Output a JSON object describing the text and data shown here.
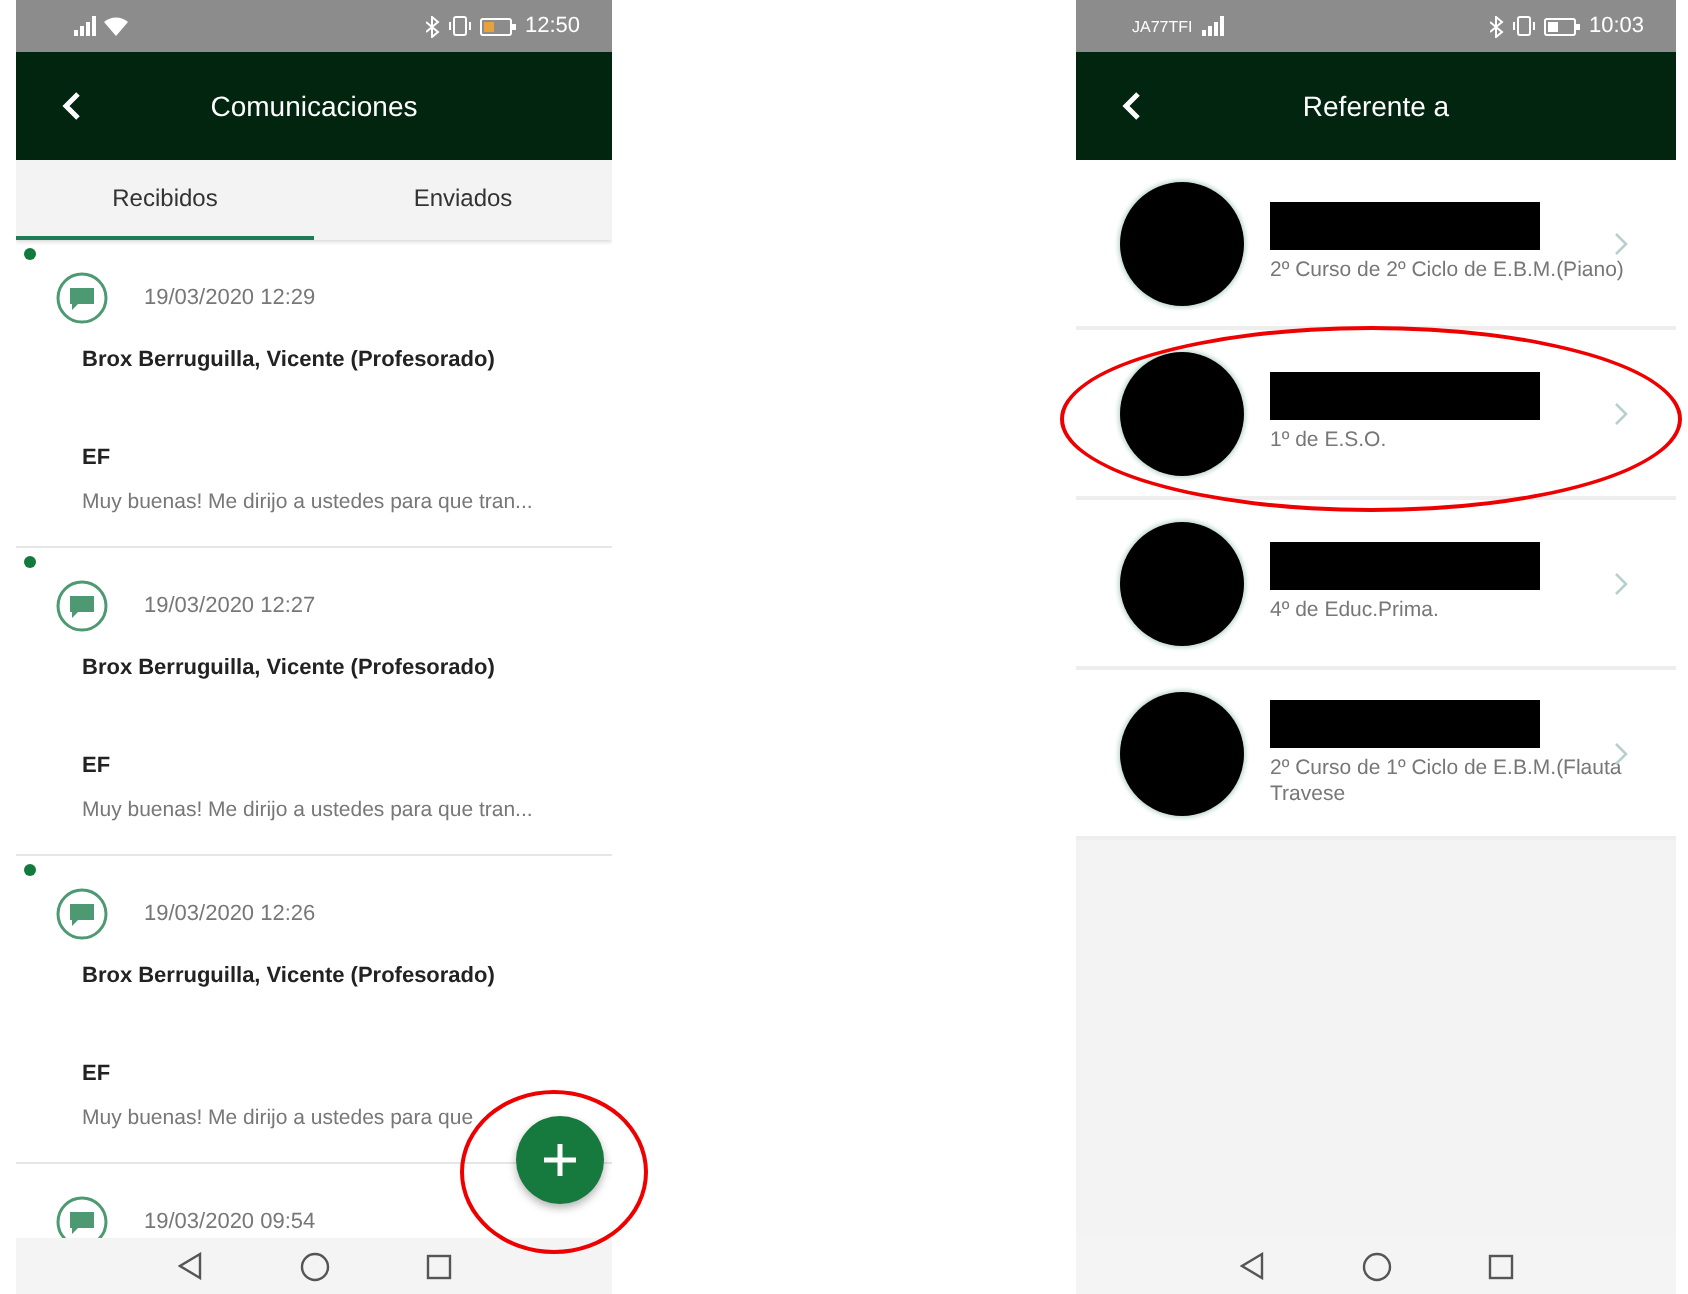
{
  "left_screen": {
    "status_bar": {
      "time": "12:50"
    },
    "header": {
      "title": "Comunicaciones"
    },
    "tabs": [
      {
        "label": "Recibidos",
        "selected": true
      },
      {
        "label": "Enviados",
        "selected": false
      }
    ],
    "messages": [
      {
        "unread": true,
        "date": "19/03/2020 12:29",
        "sender": "Brox Berruguilla, Vicente (Profesorado)",
        "subject": "EF",
        "preview": "Muy buenas! Me dirijo a ustedes para que tran..."
      },
      {
        "unread": true,
        "date": "19/03/2020 12:27",
        "sender": "Brox Berruguilla, Vicente (Profesorado)",
        "subject": "EF",
        "preview": "Muy buenas! Me dirijo a ustedes para que tran..."
      },
      {
        "unread": true,
        "date": "19/03/2020 12:26",
        "sender": "Brox Berruguilla, Vicente (Profesorado)",
        "subject": "EF",
        "preview": "Muy buenas! Me dirijo a ustedes para que"
      },
      {
        "unread": false,
        "date": "19/03/2020 09:54"
      }
    ]
  },
  "right_screen": {
    "status_bar": {
      "carrier": "JA77TFI",
      "time": "10:03"
    },
    "header": {
      "title": "Referente a"
    },
    "students": [
      {
        "course": "2º Curso de 2º Ciclo de E.B.M.(Piano)"
      },
      {
        "course": "1º de E.S.O."
      },
      {
        "course": "4º de Educ.Prima."
      },
      {
        "course": "2º Curso de 1º Ciclo de E.B.M.(Flauta Travese"
      }
    ]
  }
}
